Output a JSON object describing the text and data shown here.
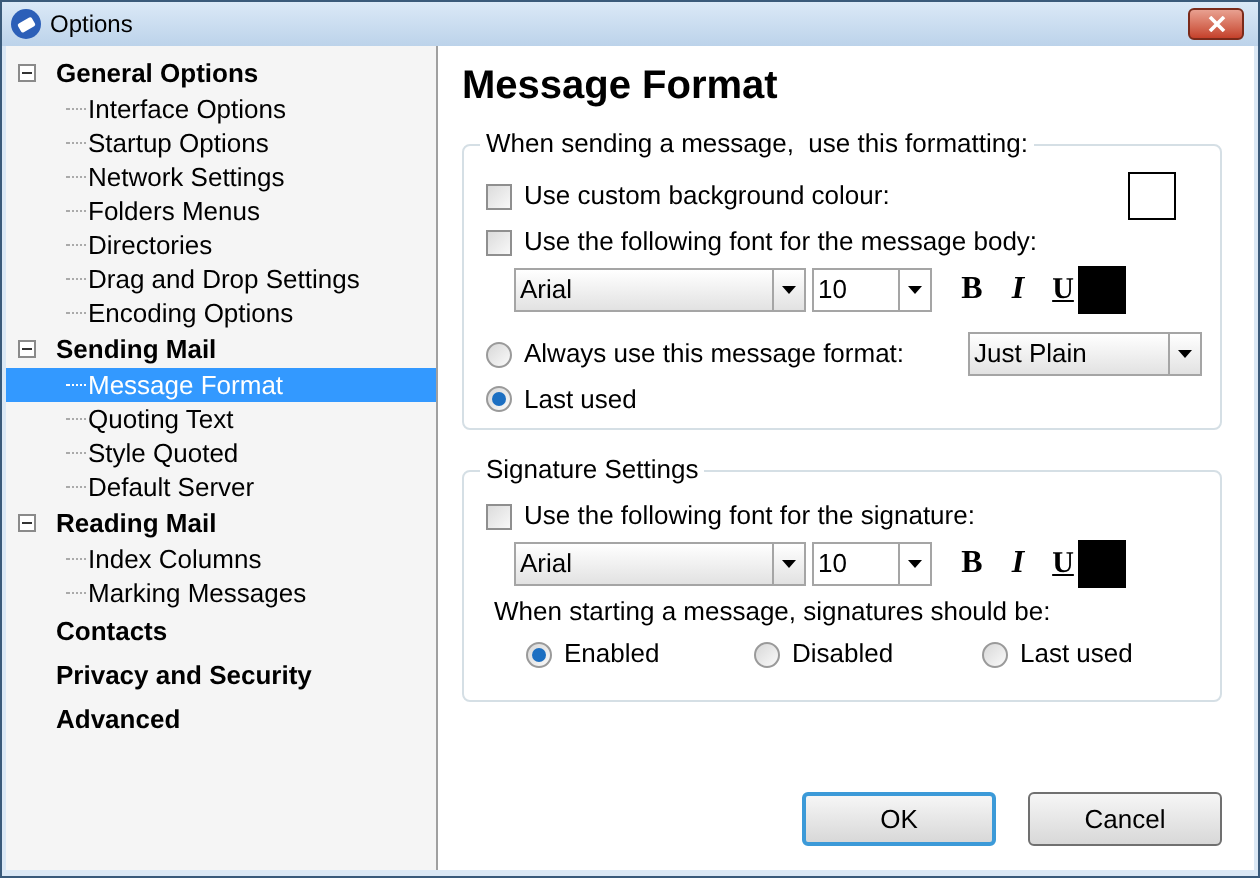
{
  "window": {
    "title": "Options"
  },
  "sidebar": {
    "items": [
      {
        "label": "General Options",
        "expanded": true,
        "selected": false,
        "children": [
          {
            "label": "Interface Options",
            "selected": false
          },
          {
            "label": "Startup Options",
            "selected": false
          },
          {
            "label": "Network Settings",
            "selected": false
          },
          {
            "label": "Folders Menus",
            "selected": false
          },
          {
            "label": "Directories",
            "selected": false
          },
          {
            "label": "Drag and Drop Settings",
            "selected": false
          },
          {
            "label": "Encoding Options",
            "selected": false
          }
        ]
      },
      {
        "label": "Sending Mail",
        "expanded": true,
        "selected": false,
        "children": [
          {
            "label": "Message Format",
            "selected": true
          },
          {
            "label": "Quoting Text",
            "selected": false
          },
          {
            "label": "Style Quoted",
            "selected": false
          },
          {
            "label": "Default Server",
            "selected": false
          }
        ]
      },
      {
        "label": "Reading Mail",
        "expanded": true,
        "selected": false,
        "children": [
          {
            "label": "Index Columns",
            "selected": false
          },
          {
            "label": "Marking Messages",
            "selected": false
          }
        ]
      },
      {
        "label": "Contacts",
        "selected": false
      },
      {
        "label": "Privacy and Security",
        "selected": false
      },
      {
        "label": "Advanced",
        "selected": false
      }
    ]
  },
  "page_title": "Message Format",
  "formatting_group": {
    "title": "When sending a message,  use this formatting:",
    "background": {
      "label": "Use custom background colour:",
      "checked": false,
      "color": "#ffffff"
    },
    "font": {
      "label": "Use the following font for the message body:",
      "checked": false,
      "font_name": "Arial",
      "font_size": "10",
      "bold": "B",
      "italic": "I",
      "underline": "U",
      "color": "#000000"
    },
    "format_options": [
      {
        "label": "Always use this message format:",
        "selected": false,
        "value": "Just Plain"
      },
      {
        "label": "Last used",
        "selected": true
      }
    ]
  },
  "signature_group": {
    "title": "Signature Settings",
    "font": {
      "label": "Use the following font for the signature:",
      "checked": false,
      "font_name": "Arial",
      "font_size": "10",
      "bold": "B",
      "italic": "I",
      "underline": "U",
      "color": "#000000"
    },
    "prompt": "When starting a message, signatures should be:",
    "options": [
      {
        "label": "Enabled",
        "selected": true
      },
      {
        "label": "Disabled",
        "selected": false
      },
      {
        "label": "Last used",
        "selected": false
      }
    ]
  },
  "buttons": [
    {
      "label": "OK",
      "default": true
    },
    {
      "label": "Cancel",
      "default": false
    }
  ]
}
